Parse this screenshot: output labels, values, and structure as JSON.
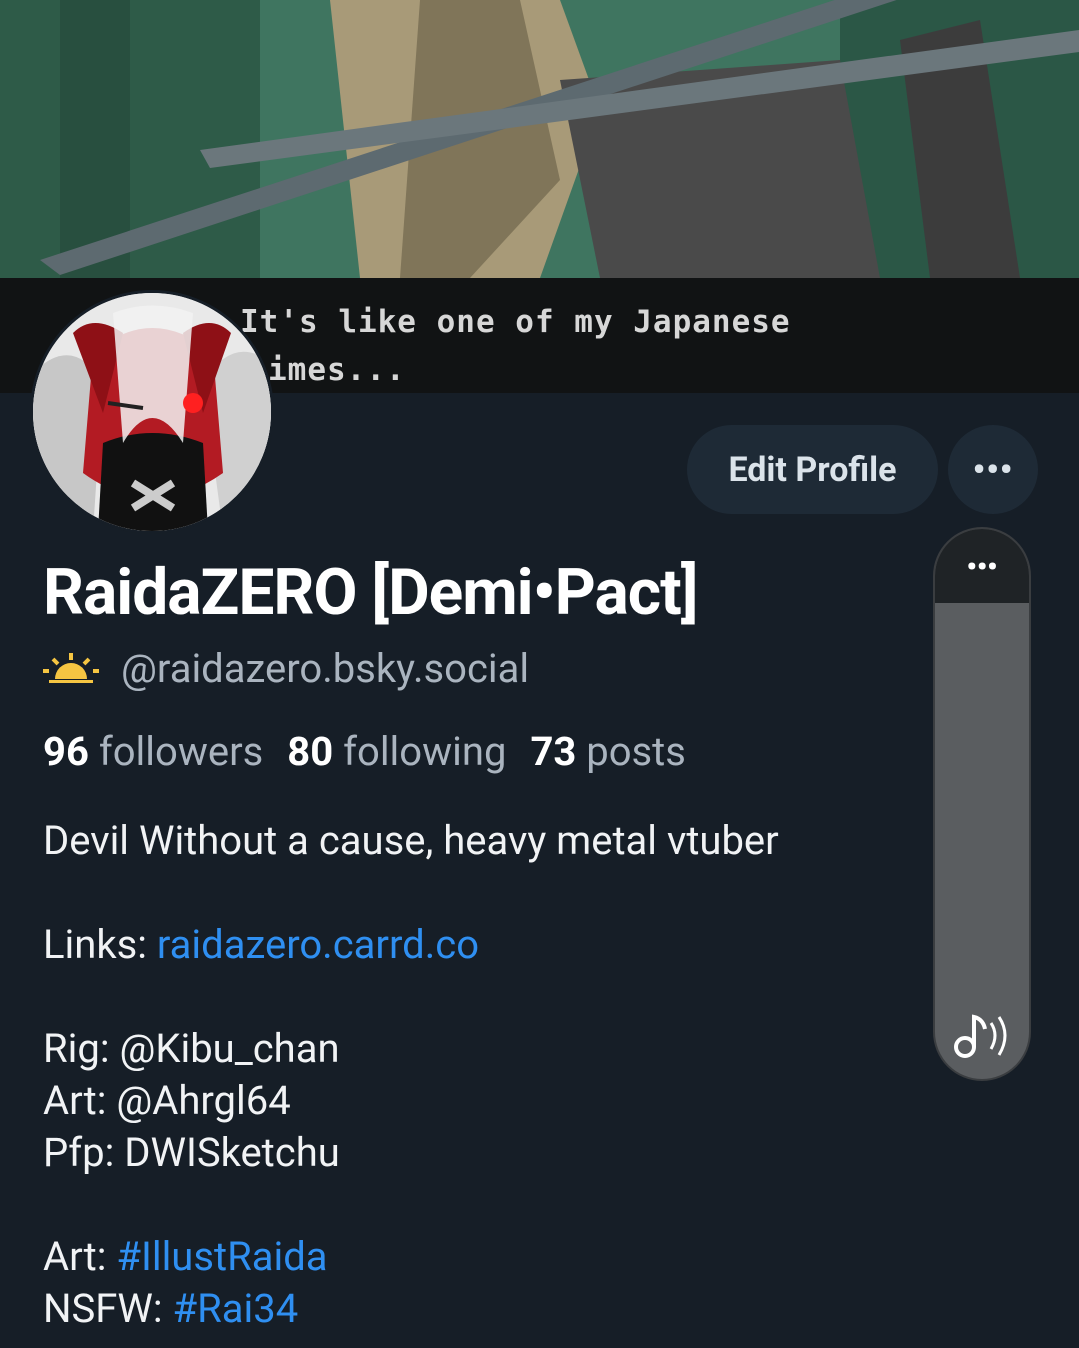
{
  "banner": {
    "caption_line1": "It's like one of my Japanese",
    "caption_line2": "imes..."
  },
  "profile": {
    "display_name": "RaidaZERO [Demi•Pact]",
    "handle": "@raidazero.bsky.social",
    "edit_label": "Edit Profile",
    "more_label": "•••"
  },
  "stats": {
    "followers_count": "96",
    "followers_label": "followers",
    "following_count": "80",
    "following_label": "following",
    "posts_count": "73",
    "posts_label": "posts"
  },
  "bio": {
    "line1": "Devil Without a cause, heavy metal vtuber",
    "links_label": "Links: ",
    "links_value": "raidazero.carrd.co",
    "rig": "Rig: @Kibu_chan",
    "art": "Art: @Ahrgl64",
    "pfp": "Pfp: DWISketchu",
    "art_tag_label": "Art: ",
    "art_tag": "#IllustRaida",
    "nsfw_label": "NSFW: ",
    "nsfw_tag": "#Rai34"
  },
  "overlay": {
    "menu_label": "•••"
  },
  "colors": {
    "background": "#161e27",
    "link": "#2f8ff1",
    "button_bg": "#1e2a36"
  }
}
